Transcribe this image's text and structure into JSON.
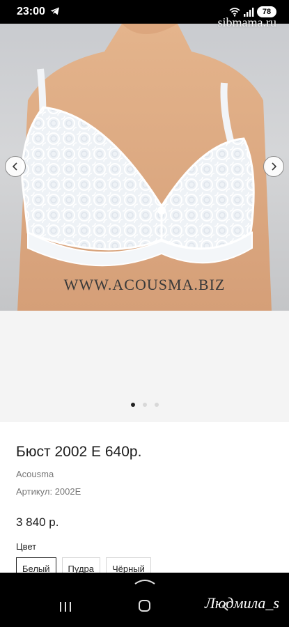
{
  "status_bar": {
    "time": "23:00",
    "battery": "78"
  },
  "watermarks": {
    "top": "sibmama.ru",
    "signature": "Людмила_s"
  },
  "gallery": {
    "caption": "WWW.ACOUSMA.BIZ",
    "slides_total": 3,
    "active_slide": 1
  },
  "product": {
    "title": "Бюст 2002 Е 640р.",
    "brand": "Acousma",
    "sku": "Артикул: 2002E",
    "price": "3 840 р.",
    "color_label": "Цвет",
    "colors": [
      "Белый",
      "Пудра",
      "Чёрный"
    ],
    "selected_color": "Белый"
  },
  "icons": {
    "status": [
      "telegram-icon",
      "wifi-icon",
      "signal-icon",
      "battery-icon"
    ],
    "gallery": [
      "chevron-left-icon",
      "chevron-right-icon"
    ],
    "navbar": [
      "chevron-up-icon",
      "recents-icon",
      "home-icon",
      "back-icon"
    ]
  }
}
